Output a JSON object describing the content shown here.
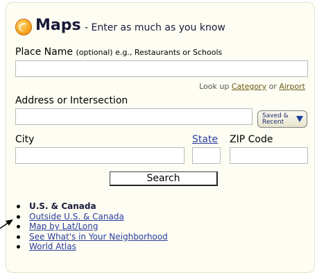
{
  "header": {
    "title": "Maps",
    "subtitle": "- Enter as much as you know"
  },
  "place": {
    "label": "Place Name",
    "hint": "(optional) e.g., Restaurants or Schools",
    "value": ""
  },
  "lookup": {
    "prefix": "Look up",
    "category_link": "Category",
    "or": "or",
    "airport_link": "Airport"
  },
  "address": {
    "label": "Address or Intersection",
    "value": ""
  },
  "saved_recent": {
    "line1": "Saved &",
    "line2": "Recent"
  },
  "city": {
    "label": "City",
    "value": ""
  },
  "state": {
    "label": "State",
    "value": ""
  },
  "zip": {
    "label": "ZIP Code",
    "value": ""
  },
  "search_button": "Search",
  "links": [
    {
      "label": "U.S. & Canada",
      "selected": true
    },
    {
      "label": "Outside U.S. & Canada"
    },
    {
      "label": "Map by Lat/Long"
    },
    {
      "label": "See What's in Your Neighborhood"
    },
    {
      "label": "World Atlas"
    }
  ],
  "colors": {
    "panel_bg": "#fdfdf3",
    "link": "#2a3c9c",
    "lookup_link": "#6d5a14",
    "logo": "#f5a623"
  }
}
